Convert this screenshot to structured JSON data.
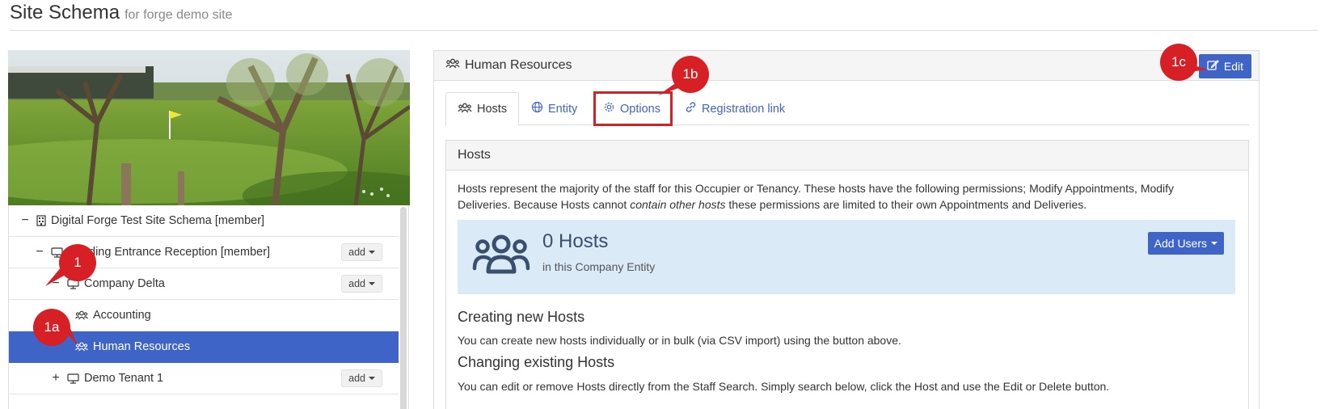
{
  "header": {
    "title": "Site Schema",
    "subtitle": "for forge demo site"
  },
  "tree": {
    "items": [
      {
        "toggle": "−",
        "icon": "building-icon",
        "label": "Digital Forge Test Site Schema [member]",
        "selected": false,
        "has_add": false
      },
      {
        "toggle": "−",
        "icon": "monitor-icon",
        "label": "Building Entrance Reception [member]",
        "visible_label": "ding Entrance Reception [member]",
        "selected": false,
        "has_add": true
      },
      {
        "toggle": "−",
        "icon": "monitor-icon",
        "label": "Company Delta",
        "selected": false,
        "has_add": true
      },
      {
        "toggle": "",
        "icon": "users-icon",
        "label": "Accounting",
        "selected": false,
        "has_add": false
      },
      {
        "toggle": "",
        "icon": "users-icon",
        "label": "Human Resources",
        "selected": true,
        "has_add": false
      },
      {
        "toggle": "+",
        "icon": "monitor-icon",
        "label": "Demo Tenant 1",
        "selected": false,
        "has_add": true
      }
    ],
    "add_label": "add"
  },
  "panel": {
    "title": "Human Resources",
    "edit_label": "Edit",
    "tabs": [
      {
        "label": "Hosts",
        "icon": "users-icon",
        "active": true
      },
      {
        "label": "Entity",
        "icon": "globe-icon",
        "active": false
      },
      {
        "label": "Options",
        "icon": "gear-icon",
        "active": false
      },
      {
        "label": "Registration link",
        "icon": "link-icon",
        "active": false
      }
    ]
  },
  "hosts": {
    "heading": "Hosts",
    "desc_part1": "Hosts represent the majority of the staff for this Occupier or Tenancy. These hosts have the following permissions; Modify Appointments, Modify",
    "desc_part2": "Deliveries. Because Hosts cannot ",
    "desc_em": "contain other hosts",
    "desc_part3": " these permissions are limited to their own Appointments and Deliveries.",
    "count_label": "0 Hosts",
    "count_sub": "in this Company Entity",
    "add_users_label": "Add Users",
    "creating_title": "Creating new Hosts",
    "creating_text": "You can create new hosts individually or in bulk (via CSV import) using the button above.",
    "changing_title": "Changing existing Hosts",
    "changing_text": "You can edit or remove Hosts directly from the Staff Search. Simply search below, click the Host and use the Edit or Delete button."
  },
  "annotations": {
    "m1": "1",
    "m1a": "1a",
    "m1b": "1b",
    "m1c": "1c"
  },
  "colors": {
    "accent": "#3f64c8",
    "annotation": "#d71f26",
    "info_box": "#daeaf6"
  }
}
